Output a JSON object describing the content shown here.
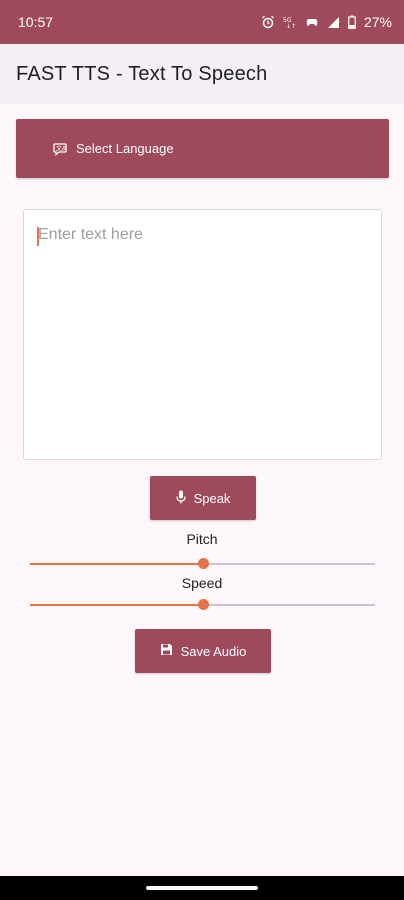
{
  "status_bar": {
    "time": "10:57",
    "battery": "27%",
    "icons": [
      "alarm-icon",
      "data-saver-icon",
      "game-controller-icon",
      "signal-icon",
      "battery-icon"
    ]
  },
  "app_bar": {
    "title": "FAST TTS - Text To Speech"
  },
  "select_language": {
    "label": "Select Language",
    "icon": "language-icon"
  },
  "text_input": {
    "value": "",
    "placeholder": "Enter text here"
  },
  "speak": {
    "label": "Speak",
    "icon": "microphone-icon"
  },
  "pitch": {
    "label": "Pitch",
    "value": 0.5
  },
  "speed": {
    "label": "Speed",
    "value": 0.5
  },
  "save_audio": {
    "label": "Save Audio",
    "icon": "floppy-disk-icon"
  },
  "colors": {
    "primary": "#9e4a5c",
    "accent": "#e2744a",
    "background": "#fdf7fb",
    "app_bar": "#f3eff5"
  }
}
